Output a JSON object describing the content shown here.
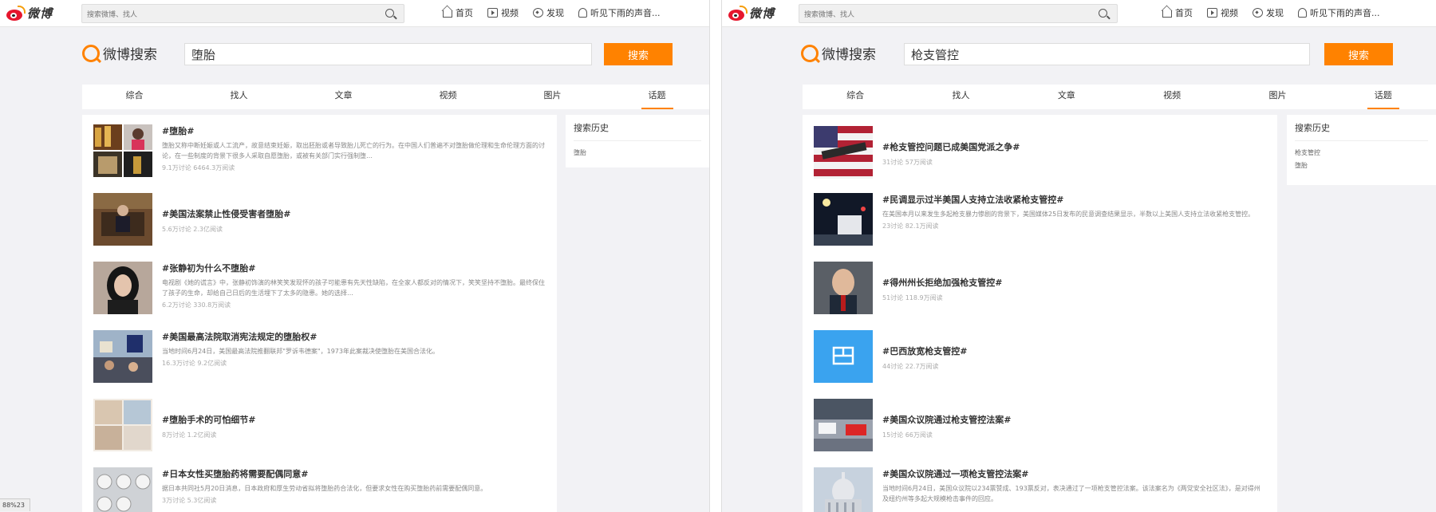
{
  "left": {
    "logo_text": "微博",
    "nav_search_placeholder": "搜索微博、找人",
    "nav": [
      "首页",
      "视频",
      "发现",
      "听见下雨的声音..."
    ],
    "search_brand": "微博搜索",
    "query": "堕胎",
    "search_button": "搜索",
    "tabs": [
      "综合",
      "找人",
      "文章",
      "视频",
      "图片",
      "话题"
    ],
    "active_tab": "话题",
    "side_title": "搜索历史",
    "history": [
      "堕胎"
    ],
    "zoom": "88%23",
    "results": [
      {
        "title": "#堕胎#",
        "desc": "堕胎又称中断妊娠或人工流产，故意结束妊娠，取出胚胎或者导致胎儿死亡的行为。在中国人们普遍不对堕胎做伦理和生命伦理方面的讨论，在一些制度的背景下很多人采取自愿堕胎，或被有关部门实行强制堕…",
        "meta": "9.1万讨论 6464.3万阅读"
      },
      {
        "title": "#美国法案禁止性侵受害者堕胎#",
        "desc": "",
        "meta": "5.6万讨论 2.3亿阅读"
      },
      {
        "title": "#张静初为什么不堕胎#",
        "desc": "电视剧《她的谎言》中，张静初饰演的林笑笑发现怀的孩子可能患有先天性缺陷，在全家人都反对的情况下，笑笑坚持不堕胎。最终保住了孩子的生命，却给自己日后的生活埋下了太多的隐患。她的选择…",
        "meta": "6.2万讨论 330.8万阅读"
      },
      {
        "title": "#美国最高法院取消宪法规定的堕胎权#",
        "desc": "当地时间6月24日，美国最高法院推翻联邦\"罗诉韦德案\"，1973年此案裁决使堕胎在美国合法化。",
        "meta": "16.3万讨论 9.2亿阅读"
      },
      {
        "title": "#堕胎手术的可怕细节#",
        "desc": "",
        "meta": "8万讨论 1.2亿阅读"
      },
      {
        "title": "#日本女性买堕胎药将需要配偶同意#",
        "desc": "据日本共同社5月20日消息，日本政府和厚生劳动省拟将堕胎药合法化，但要求女性在购买堕胎药前需要配偶同意。",
        "meta": "3万讨论 5.3亿阅读"
      }
    ]
  },
  "right": {
    "logo_text": "微博",
    "nav_search_placeholder": "搜索微博、找人",
    "nav": [
      "首页",
      "视频",
      "发现",
      "听见下雨的声音..."
    ],
    "search_brand": "微博搜索",
    "query": "枪支管控",
    "search_button": "搜索",
    "tabs": [
      "综合",
      "找人",
      "文章",
      "视频",
      "图片",
      "话题"
    ],
    "active_tab": "话题",
    "side_title": "搜索历史",
    "history": [
      "枪支管控",
      "堕胎"
    ],
    "results": [
      {
        "title": "#枪支管控问题已成美国党派之争#",
        "desc": "",
        "meta": "31讨论 57万阅读"
      },
      {
        "title": "#民调显示过半美国人支持立法收紧枪支管控#",
        "desc": "在美国本月以来发生多起枪支暴力惨剧的背景下，美国媒体25日发布的民意调查结果显示，半数以上美国人支持立法收紧枪支管控。",
        "meta": "23讨论 82.1万阅读"
      },
      {
        "title": "#得州州长拒绝加强枪支管控#",
        "desc": "",
        "meta": "51讨论 118.9万阅读"
      },
      {
        "title": "#巴西放宽枪支管控#",
        "desc": "",
        "meta": "44讨论 22.7万阅读"
      },
      {
        "title": "#美国众议院通过枪支管控法案#",
        "desc": "",
        "meta": "15讨论 66万阅读"
      },
      {
        "title": "#美国众议院通过一项枪支管控法案#",
        "desc": "当地时间6月24日，美国众议院以234票赞成、193票反对，表决通过了一项枪支管控法案。该法案名为《两党安全社区法》，是对得州及纽约州等多起大规模枪击事件的回应。",
        "meta": ""
      }
    ]
  }
}
